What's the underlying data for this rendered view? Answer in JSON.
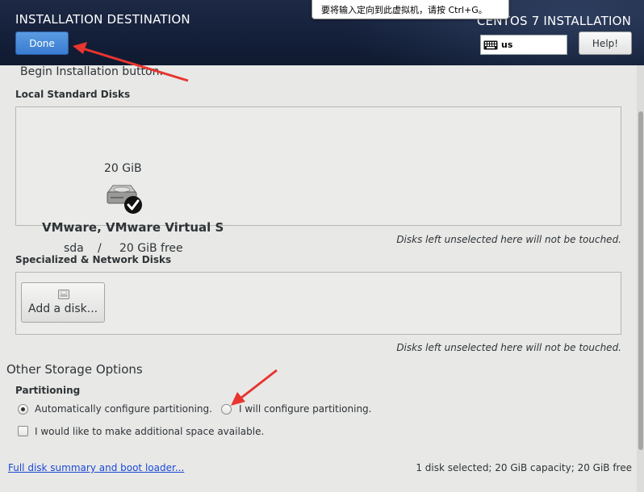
{
  "header": {
    "title": "INSTALLATION DESTINATION",
    "done_label": "Done",
    "product": "CENTOS 7 INSTALLATION",
    "keyboard_layout": "us",
    "help_label": "Help!"
  },
  "tooltip": {
    "text": "要将输入定向到此虚拟机，请按 Ctrl+G。"
  },
  "content": {
    "cut_text": "Begin Installation  button.",
    "local_disks": {
      "title": "Local Standard Disks",
      "disk": {
        "size": "20 GiB",
        "name": "VMware, VMware Virtual S",
        "device": "sda",
        "separator": "/",
        "free": "20 GiB free"
      },
      "note": "Disks left unselected here will not be touched."
    },
    "network_disks": {
      "title": "Specialized & Network Disks",
      "add_label": "Add a disk...",
      "note": "Disks left unselected here will not be touched."
    },
    "other_options": {
      "title": "Other Storage Options",
      "partitioning_label": "Partitioning",
      "auto_label": "Automatically configure partitioning.",
      "manual_label": "I will configure partitioning.",
      "selected": "auto",
      "space_label": "I would like to make additional space available.",
      "space_checked": false
    },
    "footer": {
      "link": "Full disk summary and boot loader...",
      "status": "1 disk selected; 20 GiB capacity; 20 GiB free"
    }
  },
  "colors": {
    "header_bg": "#14203a",
    "done_button": "#3a7cd1",
    "link": "#1a4ad6",
    "annotation_arrow": "#e8352f"
  }
}
